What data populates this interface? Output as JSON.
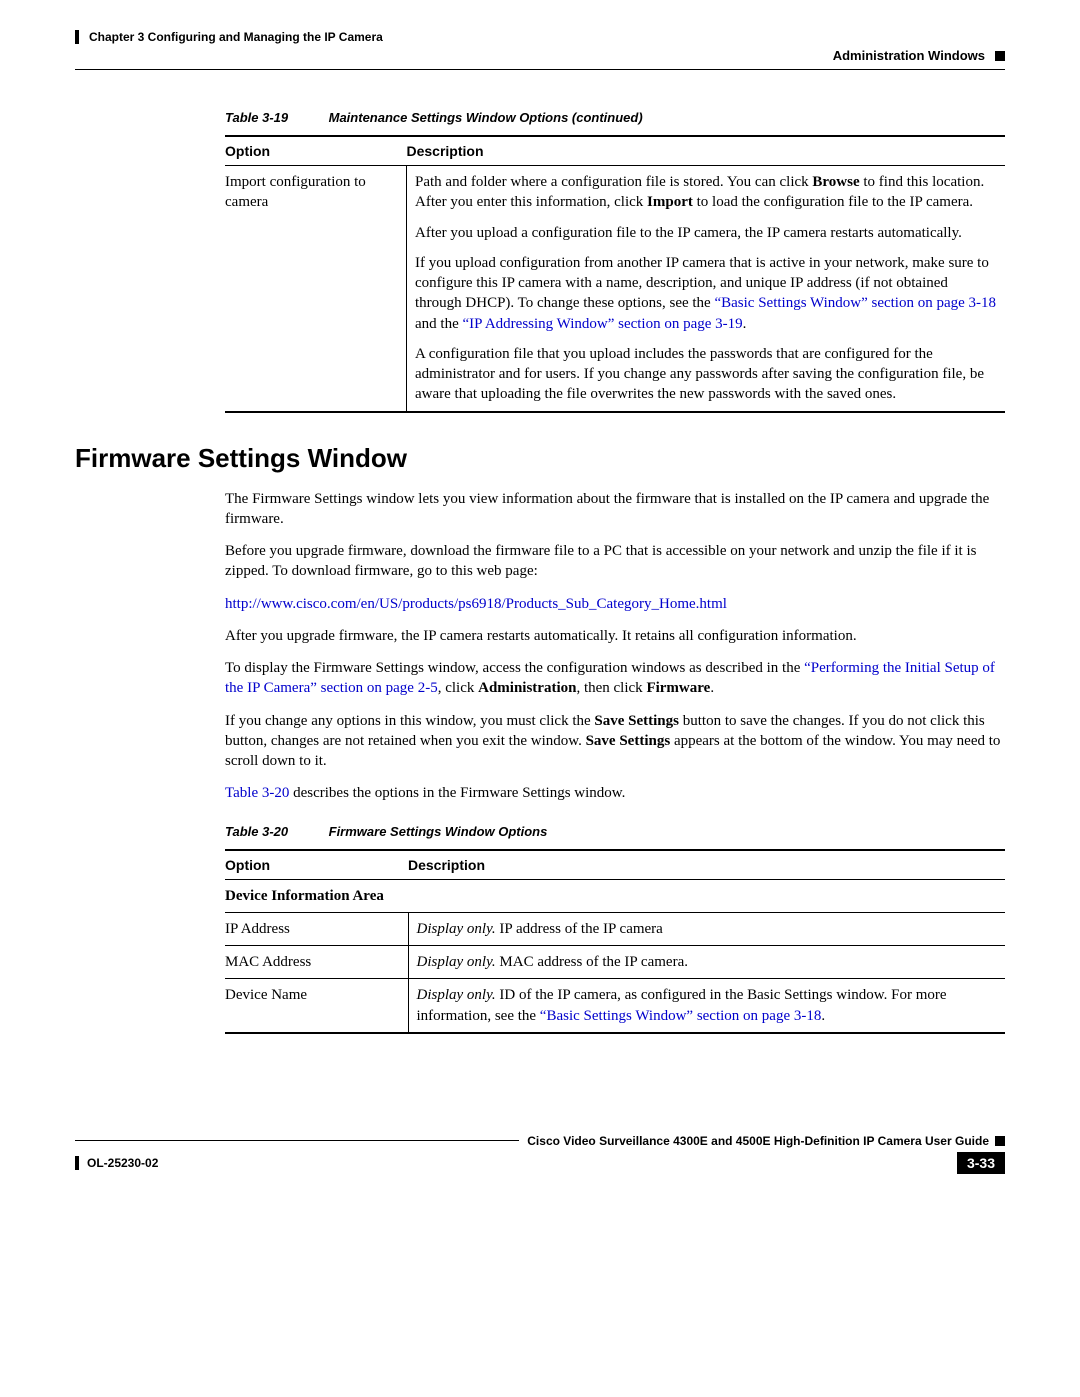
{
  "header": {
    "chapter": "Chapter 3      Configuring and Managing the IP Camera",
    "section_right": "Administration Windows"
  },
  "table19": {
    "num": "Table 3-19",
    "title": "Maintenance Settings Window Options (continued)",
    "col1": "Option",
    "col2": "Description",
    "row": {
      "option": "Import configuration to camera",
      "p1a": "Path and folder where a configuration file is stored. You can click ",
      "p1b": "Browse",
      "p1c": " to find this location. After you enter this information, click ",
      "p1d": "Import",
      "p1e": " to load the configuration file to the IP camera.",
      "p2": "After you upload a configuration file to the IP camera, the IP camera restarts automatically.",
      "p3a": "If you upload configuration from another IP camera that is active in your network, make sure to configure this IP camera with a name, description, and unique IP address (if not obtained through DHCP). To change these options, see the ",
      "p3b": "“Basic Settings Window” section on page 3-18",
      "p3c": " and the ",
      "p3d": "“IP Addressing Window” section on page 3-19",
      "p3e": ".",
      "p4": "A configuration file that you upload includes the passwords that are configured for the administrator and for users. If you change any passwords after saving the configuration file, be aware that uploading the file overwrites the new passwords with the saved ones."
    }
  },
  "section_heading": "Firmware Settings Window",
  "body": {
    "p1": "The Firmware Settings window lets you view information about the firmware that is installed on the IP camera and upgrade the firmware.",
    "p2": "Before you upgrade firmware, download the firmware file to a PC that is accessible on your network and unzip the file if it is zipped. To download firmware, go to this web page:",
    "p3_link": "http://www.cisco.com/en/US/products/ps6918/Products_Sub_Category_Home.html",
    "p4": "After you upgrade firmware, the IP camera restarts automatically. It retains all configuration information.",
    "p5a": "To display the Firmware Settings window, access the configuration windows as described in the ",
    "p5b": "“Performing the Initial Setup of the IP Camera” section on page 2-5",
    "p5c": ", click ",
    "p5d": "Administration",
    "p5e": ", then click ",
    "p5f": "Firmware",
    "p5g": ".",
    "p6a": "If you change any options in this window, you must click the ",
    "p6b": "Save Settings",
    "p6c": " button to save the changes. If you do not click this button, changes are not retained when you exit the window. ",
    "p6d": "Save Settings",
    "p6e": " appears at the bottom of the window. You may need to scroll down to it.",
    "p7a": "Table 3-20",
    "p7b": " describes the options in the Firmware Settings window."
  },
  "table20": {
    "num": "Table 3-20",
    "title": "Firmware Settings Window Options",
    "col1": "Option",
    "col2": "Description",
    "subhead": "Device Information Area",
    "rows": [
      {
        "opt": "IP Address",
        "disp": "Display only.",
        "rest": " IP address of the IP camera"
      },
      {
        "opt": "MAC Address",
        "disp": "Display only.",
        "rest": " MAC address of the IP camera."
      },
      {
        "opt": "Device Name",
        "disp": "Display only.",
        "rest_a": " ID of the IP camera, as configured in the Basic Settings window. For more information, see the ",
        "rest_link": "“Basic Settings Window” section on page 3-18",
        "rest_b": "."
      }
    ]
  },
  "footer": {
    "guide": "Cisco Video Surveillance 4300E and 4500E High-Definition IP Camera User Guide",
    "docnum": "OL-25230-02",
    "pagenum": "3-33"
  }
}
